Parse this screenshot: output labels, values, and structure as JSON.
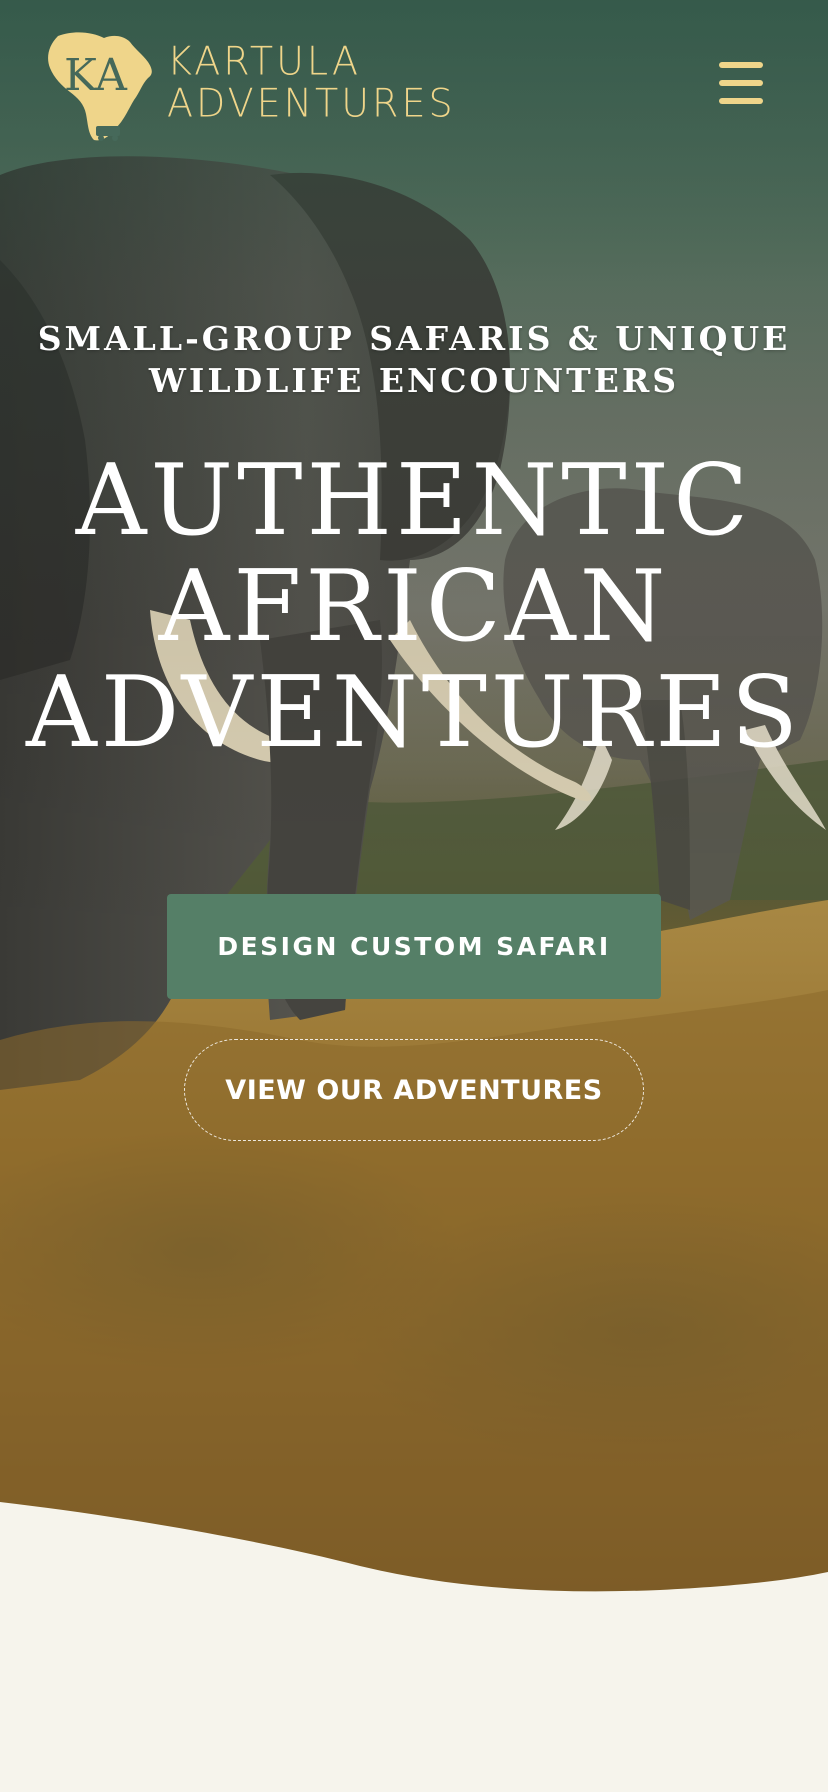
{
  "header": {
    "brand_line1": "KARTULA",
    "brand_line2": "ADVENTURES",
    "logo_monogram": "KA",
    "logo_icon": "africa-map-logo-icon",
    "menu_icon": "hamburger-menu-icon"
  },
  "hero": {
    "subtitle_line1": "SMALL-GROUP SAFARIS & UNIQUE",
    "subtitle_line2": "WILDLIFE ENCOUNTERS",
    "headline_line1": "AUTHENTIC",
    "headline_line2": "AFRICAN",
    "headline_line3": "ADVENTURES",
    "background_image": "elephants-in-savanna-photo",
    "primary_button": "DESIGN CUSTOM SAFARI",
    "secondary_button": "VIEW OUR ADVENTURES"
  },
  "colors": {
    "gold": "#efd58a",
    "green_button": "#557f67",
    "cream_background": "#f6f4ec",
    "header_green": "#46695a"
  }
}
